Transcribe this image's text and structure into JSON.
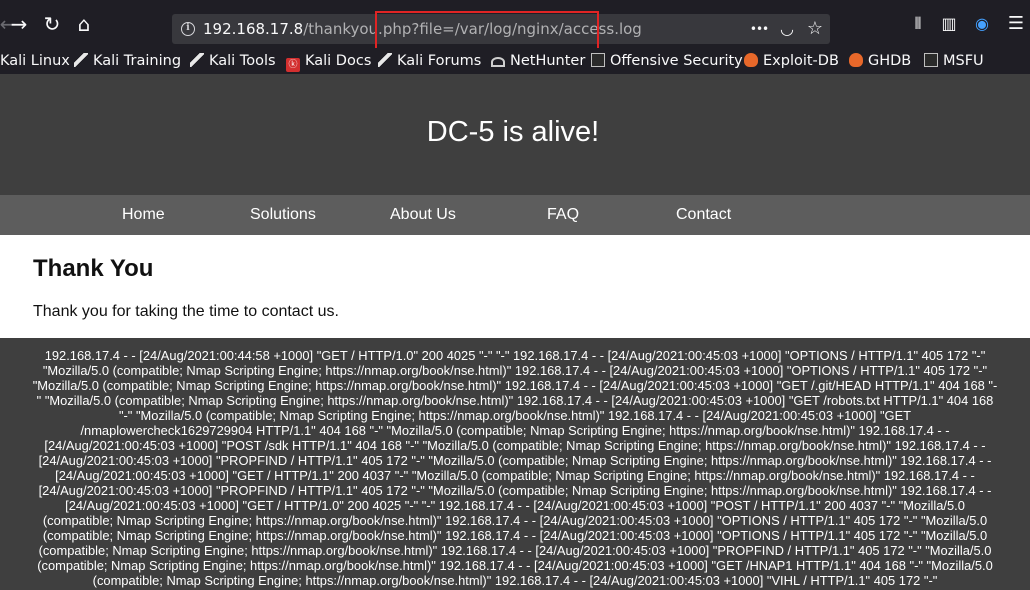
{
  "browser": {
    "url": {
      "host": "192.168.17.8",
      "path": "/thankyou.php?file=/var/log/nginx/access.log"
    },
    "buttons": {
      "back": "←",
      "forward": "→",
      "reload": "↻",
      "home": "⌂",
      "more": "•••",
      "pocket": "◡",
      "star": "☆",
      "library": "⫴",
      "sidebar": "▥",
      "account": "◉",
      "menu": "☰"
    },
    "bookmarks": [
      {
        "label": "Kali Linux",
        "icon": "kali-dragon-icon"
      },
      {
        "label": "Kali Training",
        "icon": "kali-dragon-icon"
      },
      {
        "label": "Kali Tools",
        "icon": "kali-dragon-icon"
      },
      {
        "label": "Kali Docs",
        "icon": "kali-docs-icon"
      },
      {
        "label": "Kali Forums",
        "icon": "kali-dragon-icon"
      },
      {
        "label": "NetHunter",
        "icon": "nethunter-icon"
      },
      {
        "label": "Offensive Security",
        "icon": "offsec-icon"
      },
      {
        "label": "Exploit-DB",
        "icon": "exploitdb-icon"
      },
      {
        "label": "GHDB",
        "icon": "exploitdb-icon"
      },
      {
        "label": "MSFU",
        "icon": "offsec-icon"
      }
    ]
  },
  "site": {
    "title": "DC-5 is alive!",
    "nav": [
      "Home",
      "Solutions",
      "About Us",
      "FAQ",
      "Contact"
    ]
  },
  "content": {
    "heading": "Thank You",
    "text": "Thank you for taking the time to contact us."
  },
  "log": {
    "text": "192.168.17.4 - - [24/Aug/2021:00:44:58 +1000] \"GET / HTTP/1.0\" 200 4025 \"-\" \"-\" 192.168.17.4 - - [24/Aug/2021:00:45:03 +1000] \"OPTIONS / HTTP/1.1\" 405 172 \"-\" \"Mozilla/5.0 (compatible; Nmap Scripting Engine; https://nmap.org/book/nse.html)\" 192.168.17.4 - - [24/Aug/2021:00:45:03 +1000] \"OPTIONS / HTTP/1.1\" 405 172 \"-\" \"Mozilla/5.0 (compatible; Nmap Scripting Engine; https://nmap.org/book/nse.html)\" 192.168.17.4 - - [24/Aug/2021:00:45:03 +1000] \"GET /.git/HEAD HTTP/1.1\" 404 168 \"-\" \"Mozilla/5.0 (compatible; Nmap Scripting Engine; https://nmap.org/book/nse.html)\" 192.168.17.4 - - [24/Aug/2021:00:45:03 +1000] \"GET /robots.txt HTTP/1.1\" 404 168 \"-\" \"Mozilla/5.0 (compatible; Nmap Scripting Engine; https://nmap.org/book/nse.html)\" 192.168.17.4 - - [24/Aug/2021:00:45:03 +1000] \"GET /nmaplowercheck1629729904 HTTP/1.1\" 404 168 \"-\" \"Mozilla/5.0 (compatible; Nmap Scripting Engine; https://nmap.org/book/nse.html)\" 192.168.17.4 - - [24/Aug/2021:00:45:03 +1000] \"POST /sdk HTTP/1.1\" 404 168 \"-\" \"Mozilla/5.0 (compatible; Nmap Scripting Engine; https://nmap.org/book/nse.html)\" 192.168.17.4 - - [24/Aug/2021:00:45:03 +1000] \"PROPFIND / HTTP/1.1\" 405 172 \"-\" \"Mozilla/5.0 (compatible; Nmap Scripting Engine; https://nmap.org/book/nse.html)\" 192.168.17.4 - - [24/Aug/2021:00:45:03 +1000] \"GET / HTTP/1.1\" 200 4037 \"-\" \"Mozilla/5.0 (compatible; Nmap Scripting Engine; https://nmap.org/book/nse.html)\" 192.168.17.4 - - [24/Aug/2021:00:45:03 +1000] \"PROPFIND / HTTP/1.1\" 405 172 \"-\" \"Mozilla/5.0 (compatible; Nmap Scripting Engine; https://nmap.org/book/nse.html)\" 192.168.17.4 - - [24/Aug/2021:00:45:03 +1000] \"GET / HTTP/1.0\" 200 4025 \"-\" \"-\" 192.168.17.4 - - [24/Aug/2021:00:45:03 +1000] \"POST / HTTP/1.1\" 200 4037 \"-\" \"Mozilla/5.0 (compatible; Nmap Scripting Engine; https://nmap.org/book/nse.html)\" 192.168.17.4 - - [24/Aug/2021:00:45:03 +1000] \"OPTIONS / HTTP/1.1\" 405 172 \"-\" \"Mozilla/5.0 (compatible; Nmap Scripting Engine; https://nmap.org/book/nse.html)\" 192.168.17.4 - - [24/Aug/2021:00:45:03 +1000] \"OPTIONS / HTTP/1.1\" 405 172 \"-\" \"Mozilla/5.0 (compatible; Nmap Scripting Engine; https://nmap.org/book/nse.html)\" 192.168.17.4 - - [24/Aug/2021:00:45:03 +1000] \"PROPFIND / HTTP/1.1\" 405 172 \"-\" \"Mozilla/5.0 (compatible; Nmap Scripting Engine; https://nmap.org/book/nse.html)\" 192.168.17.4 - - [24/Aug/2021:00:45:03 +1000] \"GET /HNAP1 HTTP/1.1\" 404 168 \"-\" \"Mozilla/5.0 (compatible; Nmap Scripting Engine; https://nmap.org/book/nse.html)\" 192.168.17.4 - - [24/Aug/2021:00:45:03 +1000] \"VIHL / HTTP/1.1\" 405 172 \"-\""
  }
}
